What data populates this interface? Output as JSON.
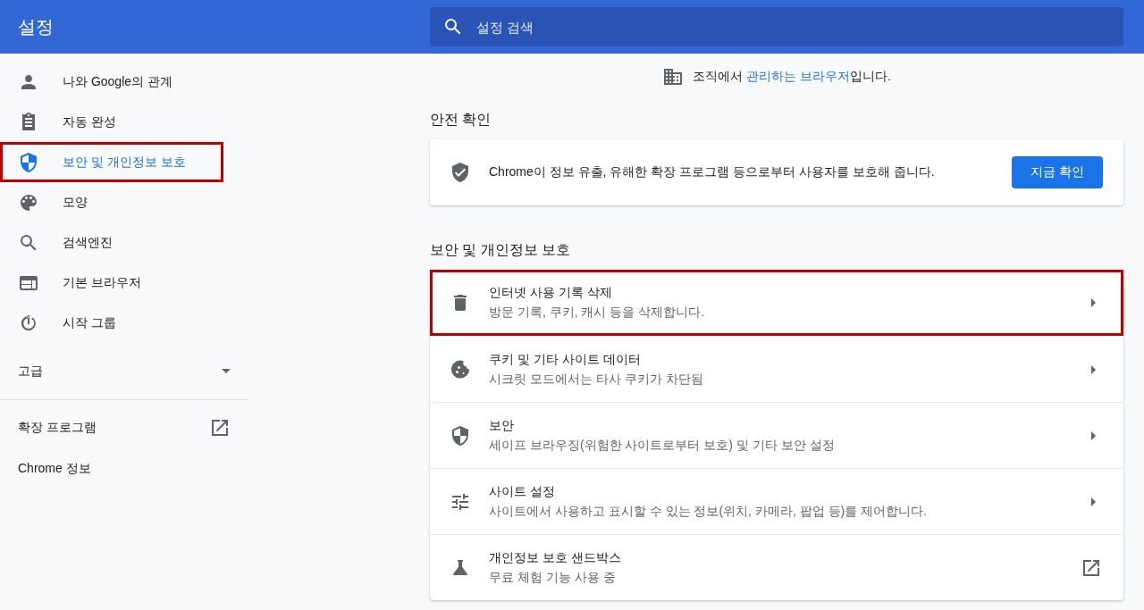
{
  "header": {
    "title": "설정",
    "search": {
      "placeholder": "설정 검색"
    }
  },
  "sidebar": {
    "items": [
      {
        "label": "나와 Google의 관계",
        "selected": false,
        "highlighted": false
      },
      {
        "label": "자동 완성",
        "selected": false,
        "highlighted": false
      },
      {
        "label": "보안 및 개인정보 보호",
        "selected": true,
        "highlighted": true
      },
      {
        "label": "모양",
        "selected": false,
        "highlighted": false
      },
      {
        "label": "검색엔진",
        "selected": false,
        "highlighted": false
      },
      {
        "label": "기본 브라우저",
        "selected": false,
        "highlighted": false
      },
      {
        "label": "시작 그룹",
        "selected": false,
        "highlighted": false
      }
    ],
    "advanced": {
      "label": "고급",
      "expanded": false
    },
    "links": [
      {
        "label": "확장 프로그램",
        "kind": "external"
      },
      {
        "label": "Chrome 정보",
        "kind": "plain"
      }
    ]
  },
  "managed_notice": {
    "before": "조직에서 ",
    "link": "관리하는 브라우저",
    "after": "입니다."
  },
  "safety_check": {
    "heading": "안전 확인",
    "text": "Chrome이 정보 유출, 유해한 확장 프로그램 등으로부터 사용자를 보호해 줍니다.",
    "button": "지금 확인"
  },
  "privacy": {
    "heading": "보안 및 개인정보 보호",
    "rows": [
      {
        "title": "인터넷 사용 기록 삭제",
        "subtitle": "방문 기록, 쿠키, 캐시 등을 삭제합니다.",
        "kind": "submenu",
        "highlighted": true
      },
      {
        "title": "쿠키 및 기타 사이트 데이터",
        "subtitle": "시크릿 모드에서는 타사 쿠키가 차단됨",
        "kind": "submenu",
        "highlighted": false
      },
      {
        "title": "보안",
        "subtitle": "세이프 브라우징(위험한 사이트로부터 보호) 및 기타 보안 설정",
        "kind": "submenu",
        "highlighted": false
      },
      {
        "title": "사이트 설정",
        "subtitle": "사이트에서 사용하고 표시할 수 있는 정보(위치, 카메라, 팝업 등)를 제어합니다.",
        "kind": "submenu",
        "highlighted": false
      },
      {
        "title": "개인정보 보호 샌드박스",
        "subtitle": "무료 체험 기능 사용 중",
        "kind": "external",
        "highlighted": false
      }
    ]
  }
}
